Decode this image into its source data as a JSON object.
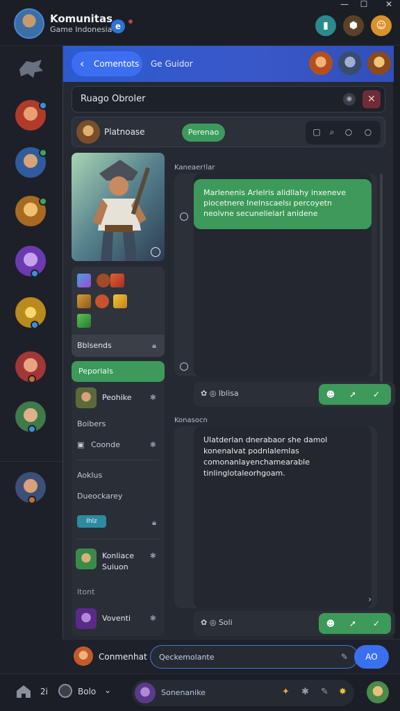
{
  "titlebar": {
    "title": "Komunitas",
    "subtitle": "Game Indonesia",
    "badge": "e",
    "win_min": "—",
    "win_max": "☐",
    "win_close": "✕"
  },
  "main": {
    "tab_active": "Comentots",
    "tab_other": "Ge Guidor"
  },
  "search": {
    "value": "Ruago Obroler"
  },
  "profile": {
    "name": "Platnoase",
    "chip": "Perenao"
  },
  "inventory": {
    "label": "Bblsends"
  },
  "friends": {
    "header": "Peporials",
    "items": [
      {
        "name": "Peohike"
      },
      {
        "name": "Boibers"
      },
      {
        "name": "Coonde"
      },
      {
        "name": "Aoklus"
      },
      {
        "name": "Dueockarey"
      },
      {
        "name": "Konliace"
      },
      {
        "name": "Suiuon"
      },
      {
        "name": "ltont"
      },
      {
        "name": "Voventi"
      }
    ],
    "chip": "Ihlz"
  },
  "chat": {
    "msg1_author": "Kaneaer!lar",
    "msg1_text": "Marlenenis Arlelris alidllahy inxeneve piocetnere lnelnscaelsı percoyetn neolvne secunelielarl anidene",
    "action1_label": "Iblisa",
    "msg2_author": "Konasocn",
    "msg2_text": "Ulatderlan dnerabaor she damol konenalvat podnlalemlas comonanlayenchamearable tinlinglotaleorhgoam.",
    "action2_label": "Soli"
  },
  "composer": {
    "label": "Conmenhat",
    "placeholder": "Qeckemolante",
    "send": "AO"
  },
  "bottombar": {
    "count": "2i",
    "status": "Bolo",
    "input": "Sonenanike"
  }
}
